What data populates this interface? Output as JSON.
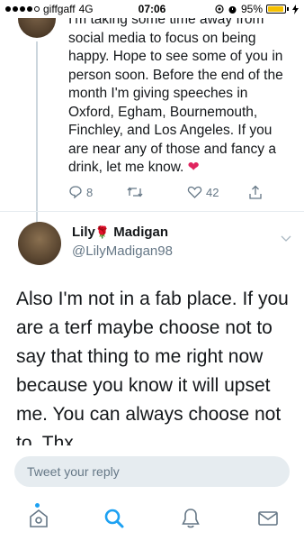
{
  "status_bar": {
    "carrier": "giffgaff",
    "network": "4G",
    "time": "07:06",
    "battery_percent": "95%",
    "battery_level": 0.95
  },
  "previous_tweet": {
    "text_lines": [
      "I'm taking some time away from",
      "social media to focus on being",
      "happy. Hope to see some of you in",
      "person soon. Before the end of the",
      "month I'm giving speeches in",
      "Oxford, Egham, Bournemouth,",
      "Finchley, and Los Angeles. If you",
      "are near any of those and fancy a",
      "drink, let me know."
    ],
    "heart_emoji": "❤",
    "reply_count": "8",
    "like_count": "42"
  },
  "main_tweet": {
    "name_part1": "Lily",
    "rose_emoji": "🌹",
    "name_part2": "Madigan",
    "handle": "@LilyMadigan98",
    "text": "Also I'm not in a fab place. If you are a terf maybe choose not to say that thing to me right now because you know it will upset me. You can always choose not to. Thx"
  },
  "reply_box": {
    "placeholder": "Tweet your reply"
  },
  "colors": {
    "accent": "#1da1f2",
    "muted": "#657786",
    "heart": "#e0245e",
    "battery": "#f5c000"
  },
  "icons": {
    "tabs": [
      "home-icon",
      "search-icon",
      "notifications-icon",
      "messages-icon"
    ]
  }
}
